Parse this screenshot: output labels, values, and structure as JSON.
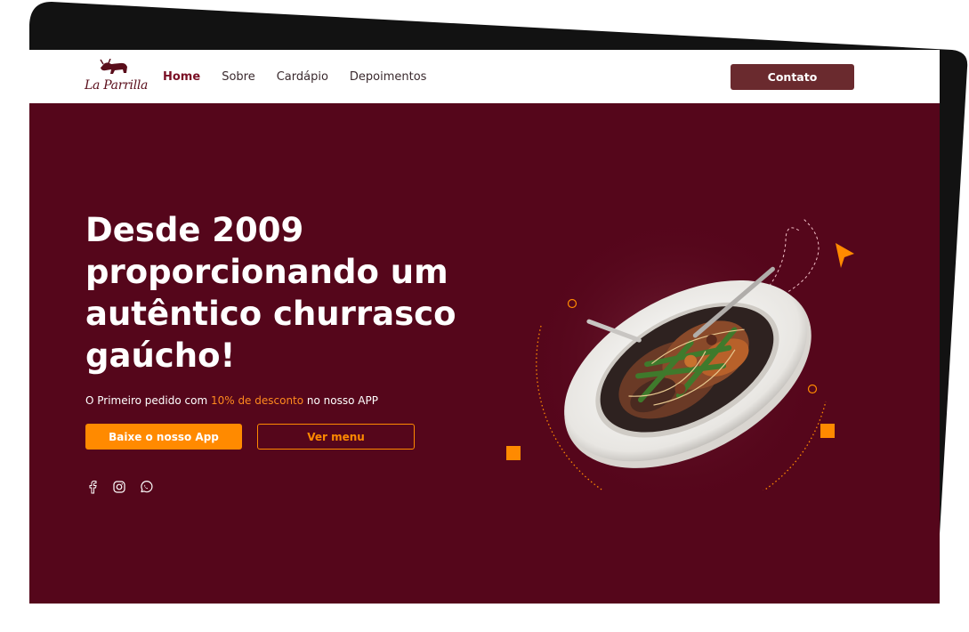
{
  "brand": {
    "logo_text": "La Parrilla",
    "logo_icon": "bull-icon"
  },
  "nav": {
    "links": [
      {
        "label": "Home",
        "active": true
      },
      {
        "label": "Sobre",
        "active": false
      },
      {
        "label": "Cardápio",
        "active": false
      },
      {
        "label": "Depoimentos",
        "active": false
      }
    ],
    "contact_label": "Contato"
  },
  "hero": {
    "headline": "Desde 2009 proporcionando um autêntico churrasco gaúcho!",
    "promo_prefix": "O Primeiro pedido com ",
    "promo_highlight": "10% de desconto",
    "promo_suffix": " no nosso APP",
    "primary_button": "Baixe o nosso App",
    "secondary_button": "Ver menu",
    "social_icons": [
      "facebook-icon",
      "instagram-icon",
      "whatsapp-icon"
    ],
    "image": "plate-of-food"
  },
  "colors": {
    "hero_bg": "#55061b",
    "accent": "#ff8a00",
    "contact_button": "#6a2a2e",
    "active_link": "#7a0f25",
    "backdrop": "#121212"
  }
}
